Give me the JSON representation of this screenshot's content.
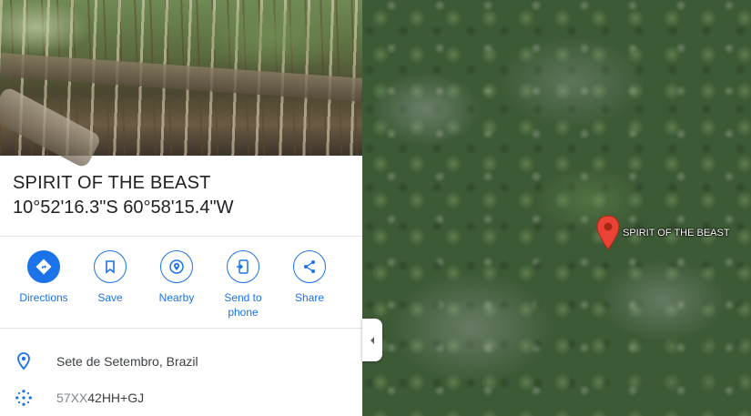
{
  "place": {
    "name": "SPIRIT OF THE BEAST",
    "coordinates": "10°52'16.3\"S 60°58'15.4\"W"
  },
  "actions": [
    {
      "label": "Directions",
      "icon": "directions-icon"
    },
    {
      "label": "Save",
      "icon": "bookmark-icon"
    },
    {
      "label": "Nearby",
      "icon": "nearby-icon"
    },
    {
      "label": "Send to\nphone",
      "label_line1": "Send to",
      "label_line2": "phone",
      "icon": "phone-icon"
    },
    {
      "label": "Share",
      "icon": "share-icon"
    }
  ],
  "info": {
    "address": "Sete de Setembro, Brazil",
    "plus_code_prefix": "57XX",
    "plus_code_rest": "42HH+GJ"
  },
  "map": {
    "marker_label": "SPIRIT OF THE BEAST",
    "marker_color": "#ea4335"
  },
  "colors": {
    "accent": "#1a73e8"
  }
}
